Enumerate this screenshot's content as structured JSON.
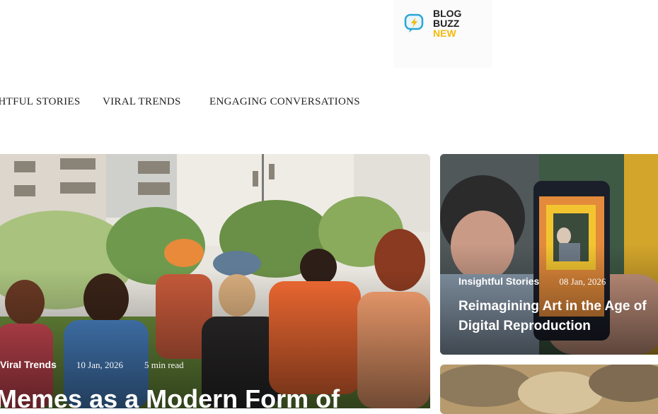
{
  "logo": {
    "line1": "BLOG",
    "line2": "BUZZ",
    "line3": "NEW",
    "accent_color": "#f5b90b",
    "icon": "speech-bubble-bolt-icon"
  },
  "nav": {
    "items": [
      {
        "label": "INSIGHTFUL STORIES"
      },
      {
        "label": "VIRAL TRENDS"
      },
      {
        "label": "ENGAGING CONVERSATIONS"
      }
    ]
  },
  "hero": {
    "category": "Viral Trends",
    "date": "10 Jan, 2026",
    "read_time": "5 min read",
    "title": "Memes as a Modern Form of"
  },
  "side_cards": [
    {
      "category": "Insightful Stories",
      "date": "08 Jan, 2026",
      "title": "Reimagining Art in the Age of Digital Reproduction"
    }
  ]
}
